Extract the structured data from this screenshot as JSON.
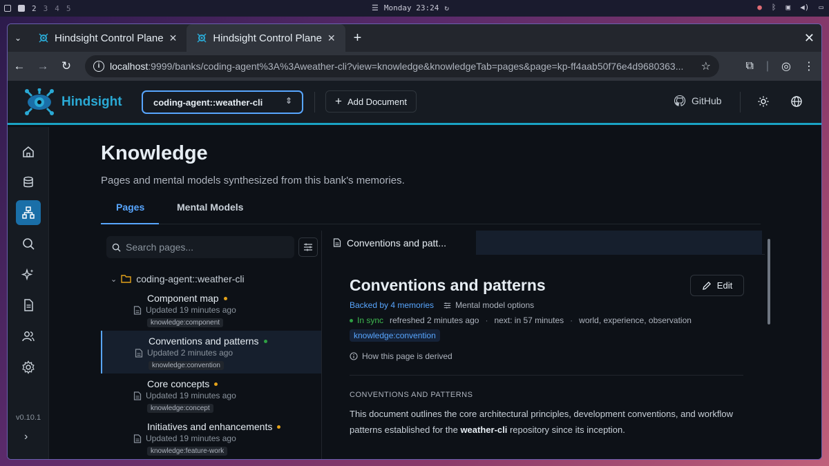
{
  "system_bar": {
    "workspaces": [
      "2",
      "3",
      "4",
      "5"
    ],
    "clock": "Monday 23:24"
  },
  "browser": {
    "tabs": [
      {
        "title": "Hindsight Control Plane"
      },
      {
        "title": "Hindsight Control Plane"
      }
    ],
    "url_host": "localhost",
    "url_rest": ":9999/banks/coding-agent%3A%3Aweather-cli?view=knowledge&knowledgeTab=pages&page=kp-ff4aab50f76e4d9680363..."
  },
  "app": {
    "brand": "Hindsight",
    "bank_selector": "coding-agent::weather-cli",
    "add_document_label": "Add Document",
    "github_label": "GitHub",
    "version": "v0.10.1"
  },
  "page": {
    "title": "Knowledge",
    "subtitle": "Pages and mental models synthesized from this bank's memories.",
    "tabs": [
      "Pages",
      "Mental Models"
    ]
  },
  "tree": {
    "search_placeholder": "Search pages...",
    "folder": "coding-agent::weather-cli",
    "items": [
      {
        "title": "Component map",
        "updated": "Updated 19 minutes ago",
        "tag": "knowledge:component",
        "status": "orange"
      },
      {
        "title": "Conventions and patterns",
        "updated": "Updated 2 minutes ago",
        "tag": "knowledge:convention",
        "status": "green"
      },
      {
        "title": "Core concepts",
        "updated": "Updated 19 minutes ago",
        "tag": "knowledge:concept",
        "status": "orange"
      },
      {
        "title": "Initiatives and enhancements",
        "updated": "Updated 19 minutes ago",
        "tag": "knowledge:feature-work",
        "status": "orange"
      }
    ]
  },
  "detail": {
    "tab_title": "Conventions and patt...",
    "title": "Conventions and patterns",
    "edit_label": "Edit",
    "backed_by": "Backed by 4 memories",
    "mental_model_options": "Mental model options",
    "sync_status": "In sync",
    "refreshed": "refreshed 2 minutes ago",
    "next": "next: in 57 minutes",
    "sources": "world, experience, observation",
    "tag": "knowledge:convention",
    "derived_link": "How this page is derived",
    "section_heading": "CONVENTIONS AND PATTERNS",
    "body_pre": "This document outlines the core architectural principles, development conventions, and workflow patterns established for the ",
    "body_bold": "weather-cli",
    "body_post": " repository since its inception."
  },
  "colors": {
    "accent": "#58a6ff",
    "brand": "#2aa9d4",
    "in_sync": "#3fb950",
    "stale": "#e3a21a"
  }
}
